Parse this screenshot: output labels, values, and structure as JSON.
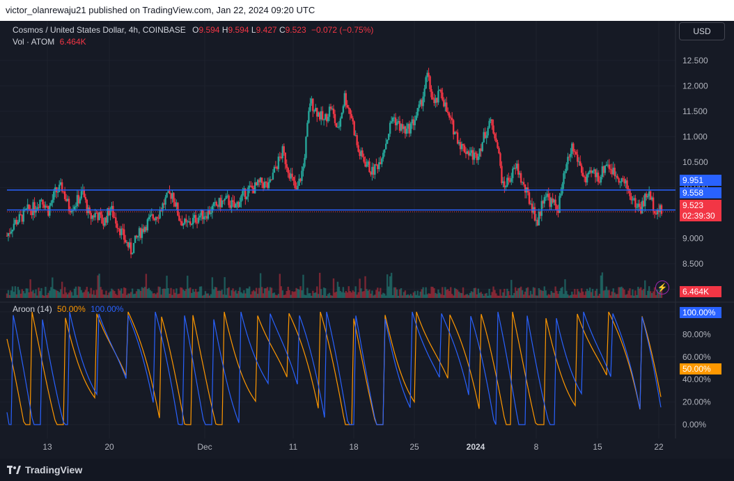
{
  "header": {
    "published_text": "victor_olanrewaju21 published on TradingView.com, Jan 22, 2024 09:20 UTC"
  },
  "legend": {
    "symbol": "Cosmos / United States Dollar, 4h, COINBASE",
    "o_label": "O",
    "o_value": "9.594",
    "h_label": "H",
    "h_value": "9.594",
    "l_label": "L",
    "l_value": "9.427",
    "c_label": "C",
    "c_value": "9.523",
    "change": "−0.072 (−0.75%)",
    "vol_label": "Vol · ATOM",
    "vol_value": "6.464K"
  },
  "currency_button": "USD",
  "price_tags": {
    "upper_line": "9.951",
    "lower_line": "9.558",
    "last_price": "9.523",
    "countdown": "02:39:30",
    "volume": "6.464K"
  },
  "aroon": {
    "title": "Aroon (14)",
    "down_value": "50.00%",
    "up_value": "100.00%",
    "up_tag": "100.00%",
    "down_tag": "50.00%"
  },
  "brand": {
    "name": "TradingView"
  },
  "colors": {
    "up": "#26a69a",
    "down": "#f23645",
    "line_blue": "#2962ff",
    "aroon_up": "#2962ff",
    "aroon_down": "#ff9800"
  },
  "chart_data": {
    "type": "candlestick",
    "title": "Cosmos / United States Dollar, 4h, COINBASE",
    "price_axis": {
      "ticks": [
        "12.500",
        "12.000",
        "11.500",
        "11.000",
        "10.500",
        "10.000",
        "9.000",
        "8.500",
        "8.000"
      ],
      "values": [
        12.5,
        12.0,
        11.5,
        11.0,
        10.5,
        10.0,
        9.0,
        8.5,
        8.0
      ],
      "range": [
        7.8,
        12.8
      ]
    },
    "horizontal_lines": [
      9.951,
      9.558
    ],
    "time_axis": {
      "labels": [
        "13",
        "20",
        "Dec",
        "11",
        "18",
        "25",
        "2024",
        "8",
        "15",
        "22"
      ]
    },
    "candles_4h_close_path": [
      [
        0,
        9.05
      ],
      [
        10,
        9.3
      ],
      [
        20,
        9.4
      ],
      [
        30,
        9.55
      ],
      [
        40,
        9.6
      ],
      [
        50,
        9.8
      ],
      [
        60,
        9.55
      ],
      [
        70,
        9.9
      ],
      [
        80,
        10.0
      ],
      [
        90,
        9.6
      ],
      [
        100,
        9.7
      ],
      [
        110,
        9.9
      ],
      [
        120,
        9.4
      ],
      [
        130,
        9.5
      ],
      [
        140,
        9.3
      ],
      [
        150,
        9.6
      ],
      [
        160,
        9.3
      ],
      [
        170,
        9.0
      ],
      [
        180,
        8.75
      ],
      [
        190,
        9.05
      ],
      [
        200,
        9.25
      ],
      [
        210,
        9.4
      ],
      [
        220,
        9.5
      ],
      [
        230,
        9.75
      ],
      [
        240,
        9.9
      ],
      [
        250,
        9.4
      ],
      [
        260,
        9.25
      ],
      [
        270,
        9.35
      ],
      [
        280,
        9.45
      ],
      [
        290,
        9.5
      ],
      [
        300,
        9.6
      ],
      [
        310,
        9.7
      ],
      [
        320,
        9.75
      ],
      [
        330,
        9.6
      ],
      [
        340,
        9.8
      ],
      [
        350,
        9.95
      ],
      [
        360,
        10.0
      ],
      [
        370,
        10.1
      ],
      [
        380,
        10.0
      ],
      [
        390,
        10.4
      ],
      [
        400,
        10.7
      ],
      [
        410,
        10.3
      ],
      [
        420,
        9.9
      ],
      [
        430,
        10.4
      ],
      [
        440,
        11.7
      ],
      [
        450,
        11.5
      ],
      [
        460,
        11.3
      ],
      [
        470,
        11.6
      ],
      [
        480,
        11.1
      ],
      [
        490,
        11.8
      ],
      [
        500,
        11.4
      ],
      [
        510,
        10.7
      ],
      [
        520,
        10.5
      ],
      [
        530,
        10.3
      ],
      [
        540,
        10.5
      ],
      [
        550,
        10.9
      ],
      [
        560,
        11.4
      ],
      [
        570,
        11.2
      ],
      [
        580,
        11.1
      ],
      [
        590,
        11.3
      ],
      [
        600,
        11.6
      ],
      [
        610,
        12.2
      ],
      [
        620,
        11.6
      ],
      [
        630,
        11.9
      ],
      [
        640,
        11.4
      ],
      [
        650,
        11.1
      ],
      [
        660,
        10.8
      ],
      [
        670,
        10.7
      ],
      [
        680,
        10.6
      ],
      [
        690,
        10.9
      ],
      [
        700,
        11.3
      ],
      [
        710,
        11.0
      ],
      [
        720,
        10.0
      ],
      [
        730,
        10.2
      ],
      [
        740,
        10.4
      ],
      [
        750,
        10.0
      ],
      [
        760,
        9.7
      ],
      [
        770,
        9.3
      ],
      [
        780,
        9.9
      ],
      [
        790,
        9.7
      ],
      [
        800,
        9.6
      ],
      [
        810,
        10.3
      ],
      [
        820,
        10.8
      ],
      [
        830,
        10.5
      ],
      [
        840,
        10.1
      ],
      [
        850,
        10.3
      ],
      [
        860,
        10.2
      ],
      [
        870,
        10.5
      ],
      [
        880,
        10.3
      ],
      [
        890,
        10.2
      ],
      [
        900,
        10.0
      ],
      [
        910,
        9.7
      ],
      [
        920,
        9.6
      ],
      [
        930,
        9.9
      ],
      [
        940,
        9.6
      ],
      [
        950,
        9.52
      ]
    ],
    "aroon_axis": {
      "ticks": [
        "100.00%",
        "80.00%",
        "60.00%",
        "40.00%",
        "20.00%",
        "0.00%"
      ],
      "values": [
        100,
        80,
        60,
        40,
        20,
        0
      ]
    },
    "series": [
      {
        "name": "Aroon Up",
        "last": 100.0
      },
      {
        "name": "Aroon Down",
        "last": 50.0
      }
    ]
  }
}
